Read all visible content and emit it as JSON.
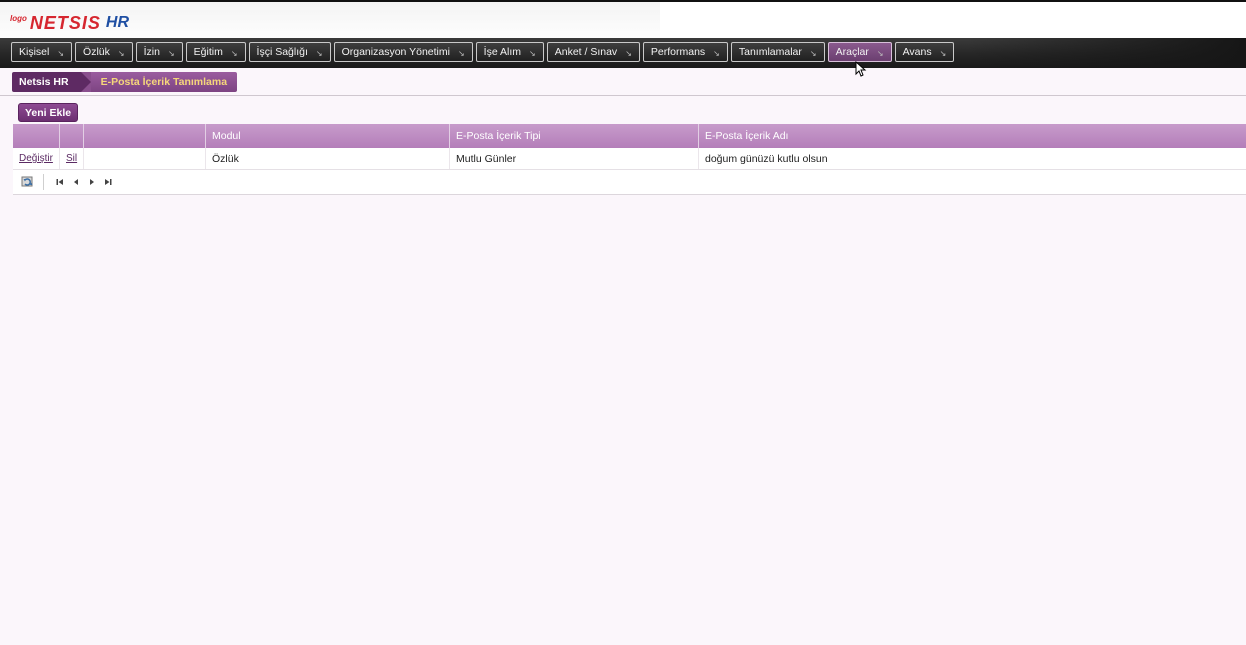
{
  "header": {
    "logo_small": "logo",
    "logo_brand": "NETSIS",
    "logo_product": "HR"
  },
  "nav": {
    "items": [
      {
        "label": "Kişisel",
        "active": false
      },
      {
        "label": "Özlük",
        "active": false
      },
      {
        "label": "İzin",
        "active": false
      },
      {
        "label": "Eğitim",
        "active": false
      },
      {
        "label": "İşçi Sağlığı",
        "active": false
      },
      {
        "label": "Organizasyon Yönetimi",
        "active": false
      },
      {
        "label": "İşe Alım",
        "active": false
      },
      {
        "label": "Anket / Sınav",
        "active": false
      },
      {
        "label": "Performans",
        "active": false
      },
      {
        "label": "Tanımlamalar",
        "active": false
      },
      {
        "label": "Araçlar",
        "active": true
      },
      {
        "label": "Avans",
        "active": false
      }
    ]
  },
  "breadcrumb": {
    "root": "Netsis HR",
    "current": "E-Posta İçerik Tanımlama"
  },
  "toolbar": {
    "add_label": "Yeni Ekle"
  },
  "grid": {
    "columns": [
      "",
      "",
      "",
      "Modul",
      "E-Posta İçerik Tipi",
      "E-Posta İçerik Adı"
    ],
    "rows": [
      {
        "edit_label": "Değiştir",
        "delete_label": "Sil",
        "modul": "Özlük",
        "tip": "Mutlu Günler",
        "adi": "doğum günüzü kutlu olsun"
      }
    ]
  },
  "colors": {
    "accent": "#6c2f71",
    "header_purple": "#b47eb9",
    "breadcrumb_text": "#f5d77a",
    "logo_red": "#d6262f",
    "logo_blue": "#1f4fa3"
  },
  "icons": {
    "refresh": "refresh-icon",
    "first": "first-page-icon",
    "prev": "prev-page-icon",
    "next": "next-page-icon",
    "last": "last-page-icon"
  }
}
